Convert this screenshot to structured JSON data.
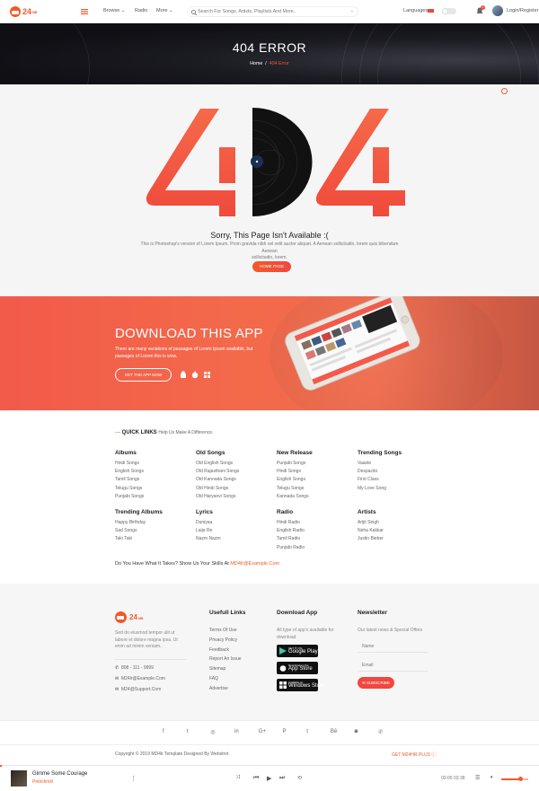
{
  "header": {
    "logo_text": "24",
    "logo_sub": "MB",
    "nav": {
      "browse": "Browse",
      "radio": "Radio",
      "more": "More"
    },
    "search_placeholder": "Search For Songs, Artists, Playlists And More..",
    "languages": "Languages",
    "notif_count": "2",
    "login": "Login/Register"
  },
  "banner": {
    "title": "404 ERROR",
    "crumb_home": "Home",
    "crumb_sep": "/",
    "crumb_current": "404 Error"
  },
  "error": {
    "title": "Sorry, This Page Isn't Available :(",
    "text_line1": "This is Photoshop's version of Lorem Ipsum. Proin gravida nibh vel velit auctor aliquet. A Aenean sollicitudin, lorem quis bibendum Aenean",
    "text_line2": "sollicitudin, lorem.",
    "button": "HOME PAGE"
  },
  "app_promo": {
    "title": "DOWNLOAD THIS APP",
    "desc_line1": "There are many variations of passages of Lorem Ipsum available, but",
    "desc_line2": "passages of Lorem this is wow.",
    "button": "GET THE APP NOW"
  },
  "quick_links": {
    "heading": "QUICK LINKS",
    "subheading": "Help Us Make A Difference.",
    "columns": [
      {
        "title": "Albums",
        "items": [
          "Hindi Songs",
          "English Songs",
          "Tamil Songs",
          "Telugu Songs",
          "Punjabi Songs"
        ]
      },
      {
        "title": "Old Songs",
        "items": [
          "Old English Songs",
          "Old Rajasthani Songs",
          "Old Kannada Songs",
          "Old Hindi Songs",
          "Old Haryanvi Songs"
        ]
      },
      {
        "title": "New Release",
        "items": [
          "Punjabi Songs",
          "Hindi Songs",
          "English Songs",
          "Telugu Songs",
          "Kannada Songs"
        ]
      },
      {
        "title": "Trending Songs",
        "items": [
          "Vaaste",
          "Despacito",
          "First Class",
          "My Love Song"
        ]
      },
      {
        "title": "Trending Albums",
        "items": [
          "Happy Birthday",
          "Sad Songs",
          "Taki Taki"
        ]
      },
      {
        "title": "Lyrics",
        "items": [
          "Duniyaa",
          "Laija Re",
          "Nazm Nazm"
        ]
      },
      {
        "title": "Radio",
        "items": [
          "Hindi Radio",
          "English Radio",
          "Tamil Radio",
          "Punjabi Radio"
        ]
      },
      {
        "title": "Artists",
        "items": [
          "Arijit Singh",
          "Neha Kakkar",
          "Justin Bieber"
        ]
      }
    ],
    "bottom_text": "Do You Have What It Takes? Show Us Your Skills At",
    "bottom_email": "MD4lr@Example.Com"
  },
  "footer": {
    "about_line1": "Sed do eiusmod tempor ulit ut",
    "about_line2": "labore et dolore magna ipsa. Ut",
    "about_line3": "enim ad minim veniam..",
    "phone": "808 - 111 - 9999",
    "email1": "M24lr@Example.Com",
    "email2": "M24@Support.Com",
    "useful_title": "Usefull Links",
    "useful_links": [
      "Terms Of Use",
      "Privacy Policy",
      "Feedback",
      "Report An Issue",
      "Sitemap",
      "FAQ",
      "Advertise"
    ],
    "app_title": "Download App",
    "app_text_line1": "All type of app's available for",
    "app_text_line2": "download",
    "stores": [
      {
        "small": "GET IT ON",
        "big": "Google Play"
      },
      {
        "small": "Download on the",
        "big": "App Store"
      },
      {
        "small": "Available on",
        "big": "Windows Store"
      }
    ],
    "news_title": "Newsletter",
    "news_text": "Our latest news & Special Offers",
    "name_placeholder": "Name",
    "email_placeholder": "Email",
    "subscribe": "SUBSCRIBE"
  },
  "social": [
    "f",
    "t",
    "◎",
    "in",
    "G+",
    "P",
    "t",
    "Bē",
    "◙",
    "✆"
  ],
  "copyright": "Copyright © 2019 MD4lr Template Designed By Webstrot",
  "get_plus": "GET M24HR PLUS",
  "player": {
    "title": "Gimme Some Courage",
    "artist": "Petrickmill",
    "time_current": "00:00",
    "time_total": "03:38",
    "volume": 0.7
  },
  "colors": {
    "accent": "#f15a29",
    "accent2": "#f0473f"
  }
}
